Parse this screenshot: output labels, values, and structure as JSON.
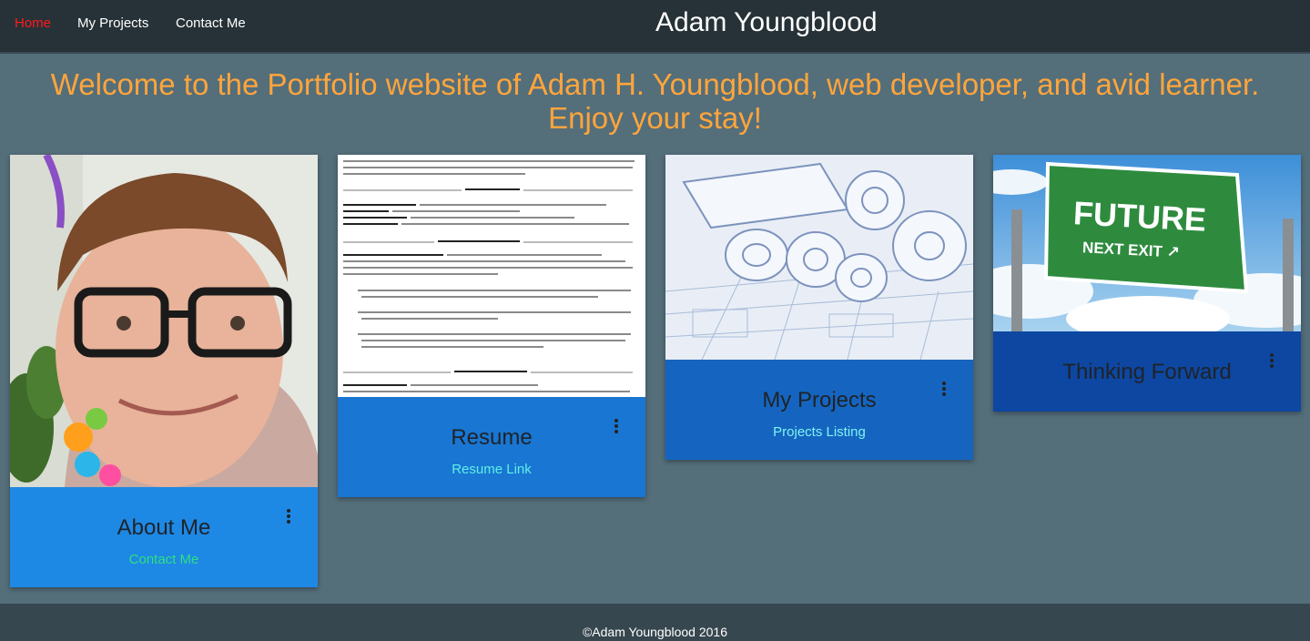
{
  "nav": {
    "home": "Home",
    "projects": "My Projects",
    "contact": "Contact Me"
  },
  "site_title": "Adam Youngblood",
  "welcome": {
    "line1": "Welcome to the Portfolio website of Adam H. Youngblood, web developer, and avid learner.",
    "line2": "Enjoy your stay!"
  },
  "cards": [
    {
      "title": "About Me",
      "link": "Contact Me",
      "image": "profile-photo",
      "color": "#1e88e5",
      "link_color": "#2ee080"
    },
    {
      "title": "Resume",
      "link": "Resume Link",
      "image": "resume-document",
      "color": "#1976d2",
      "link_color": "#5ff0e6"
    },
    {
      "title": "My Projects",
      "link": "Projects Listing",
      "image": "blueprints",
      "color": "#1565c0",
      "link_color": "#7ff2f2"
    },
    {
      "title": "Thinking Forward",
      "link": "",
      "image": "future-sign",
      "color": "#0d47a1",
      "link_color": "#7ff2f2"
    }
  ],
  "sign": {
    "line1": "FUTURE",
    "line2": "NEXT EXIT"
  },
  "icons": [
    "more-vert-icon"
  ],
  "footer": "©Adam Youngblood 2016"
}
